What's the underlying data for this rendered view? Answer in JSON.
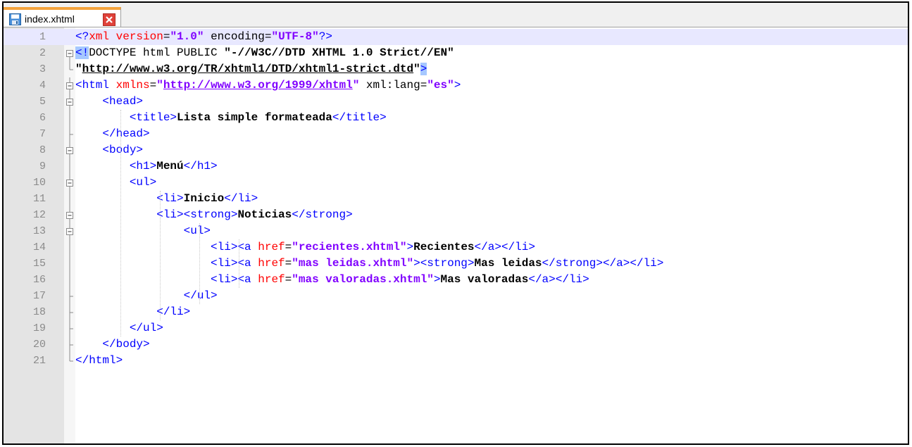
{
  "tab": {
    "label": "index.xhtml"
  },
  "colors": {
    "tag": "#0000ff",
    "attribute": "#ff0000",
    "value": "#8000ff",
    "current_line": "#e8e8ff",
    "tab_accent": "#f3a33c"
  },
  "lines": [
    {
      "n": "1",
      "current": true,
      "fold": "none",
      "parts": [
        {
          "c": "tag",
          "t": "<?"
        },
        {
          "c": "attr",
          "t": "xml"
        },
        {
          "c": "plain",
          "t": " "
        },
        {
          "c": "attr",
          "t": "version"
        },
        {
          "c": "plain",
          "t": "="
        },
        {
          "c": "val",
          "t": "\"1.0\""
        },
        {
          "c": "plain",
          "t": " "
        },
        {
          "c": "plain",
          "t": "encoding"
        },
        {
          "c": "plain",
          "t": "="
        },
        {
          "c": "val",
          "t": "\"UTF-8\""
        },
        {
          "c": "tag",
          "t": "?>"
        }
      ]
    },
    {
      "n": "2",
      "fold": "open",
      "parts": [
        {
          "c": "tag hl",
          "t": "<!"
        },
        {
          "c": "plain",
          "t": "DOCTYPE html PUBLIC "
        },
        {
          "c": "plain txt",
          "t": "\"-//W3C//DTD XHTML 1.0 Strict//EN\""
        }
      ]
    },
    {
      "n": "3",
      "fold": "end",
      "parts": [
        {
          "c": "plain txt",
          "t": "\""
        },
        {
          "c": "plain txt ulink",
          "t": "http://www.w3.org/TR/xhtml1/DTD/xhtml1-strict.dtd"
        },
        {
          "c": "plain txt",
          "t": "\""
        },
        {
          "c": "tag hl",
          "t": ">"
        }
      ]
    },
    {
      "n": "4",
      "fold": "open",
      "parts": [
        {
          "c": "tag",
          "t": "<html"
        },
        {
          "c": "plain",
          "t": " "
        },
        {
          "c": "attr",
          "t": "xmlns"
        },
        {
          "c": "plain",
          "t": "="
        },
        {
          "c": "val",
          "t": "\""
        },
        {
          "c": "val ulink",
          "t": "http://www.w3.org/1999/xhtml"
        },
        {
          "c": "val",
          "t": "\""
        },
        {
          "c": "plain",
          "t": " xml:lang="
        },
        {
          "c": "val",
          "t": "\"es\""
        },
        {
          "c": "tag",
          "t": ">"
        }
      ]
    },
    {
      "n": "5",
      "fold": "open",
      "parts": [
        {
          "c": "plain",
          "t": "    "
        },
        {
          "c": "tag",
          "t": "<head>"
        }
      ]
    },
    {
      "n": "6",
      "fold": "line",
      "parts": [
        {
          "c": "plain",
          "t": "        "
        },
        {
          "c": "tag",
          "t": "<title>"
        },
        {
          "c": "txt",
          "t": "Lista simple formateada"
        },
        {
          "c": "tag",
          "t": "</title>"
        }
      ]
    },
    {
      "n": "7",
      "fold": "branch-end",
      "parts": [
        {
          "c": "plain",
          "t": "    "
        },
        {
          "c": "tag",
          "t": "</head>"
        }
      ]
    },
    {
      "n": "8",
      "fold": "open",
      "parts": [
        {
          "c": "plain",
          "t": "    "
        },
        {
          "c": "tag",
          "t": "<body>"
        }
      ]
    },
    {
      "n": "9",
      "fold": "line",
      "parts": [
        {
          "c": "plain",
          "t": "        "
        },
        {
          "c": "tag",
          "t": "<h1>"
        },
        {
          "c": "txt",
          "t": "Menú"
        },
        {
          "c": "tag",
          "t": "</h1>"
        }
      ]
    },
    {
      "n": "10",
      "fold": "open",
      "parts": [
        {
          "c": "plain",
          "t": "        "
        },
        {
          "c": "tag",
          "t": "<ul>"
        }
      ]
    },
    {
      "n": "11",
      "fold": "line",
      "parts": [
        {
          "c": "plain",
          "t": "            "
        },
        {
          "c": "tag",
          "t": "<li>"
        },
        {
          "c": "txt",
          "t": "Inicio"
        },
        {
          "c": "tag",
          "t": "</li>"
        }
      ]
    },
    {
      "n": "12",
      "fold": "open",
      "parts": [
        {
          "c": "plain",
          "t": "            "
        },
        {
          "c": "tag",
          "t": "<li><strong>"
        },
        {
          "c": "txt",
          "t": "Noticias"
        },
        {
          "c": "tag",
          "t": "</strong>"
        }
      ]
    },
    {
      "n": "13",
      "fold": "open",
      "parts": [
        {
          "c": "plain",
          "t": "                "
        },
        {
          "c": "tag",
          "t": "<ul>"
        }
      ]
    },
    {
      "n": "14",
      "fold": "line",
      "parts": [
        {
          "c": "plain",
          "t": "                    "
        },
        {
          "c": "tag",
          "t": "<li><a"
        },
        {
          "c": "plain",
          "t": " "
        },
        {
          "c": "attr",
          "t": "href"
        },
        {
          "c": "plain",
          "t": "="
        },
        {
          "c": "val",
          "t": "\"recientes.xhtml\""
        },
        {
          "c": "tag",
          "t": ">"
        },
        {
          "c": "txt",
          "t": "Recientes"
        },
        {
          "c": "tag",
          "t": "</a></li>"
        }
      ]
    },
    {
      "n": "15",
      "fold": "line",
      "parts": [
        {
          "c": "plain",
          "t": "                    "
        },
        {
          "c": "tag",
          "t": "<li><a"
        },
        {
          "c": "plain",
          "t": " "
        },
        {
          "c": "attr",
          "t": "href"
        },
        {
          "c": "plain",
          "t": "="
        },
        {
          "c": "val",
          "t": "\"mas leidas.xhtml\""
        },
        {
          "c": "tag",
          "t": "><strong>"
        },
        {
          "c": "txt",
          "t": "Mas leidas"
        },
        {
          "c": "tag",
          "t": "</strong></a></li>"
        }
      ]
    },
    {
      "n": "16",
      "fold": "line",
      "parts": [
        {
          "c": "plain",
          "t": "                    "
        },
        {
          "c": "tag",
          "t": "<li><a"
        },
        {
          "c": "plain",
          "t": " "
        },
        {
          "c": "attr",
          "t": "href"
        },
        {
          "c": "plain",
          "t": "="
        },
        {
          "c": "val",
          "t": "\"mas valoradas.xhtml\""
        },
        {
          "c": "tag",
          "t": ">"
        },
        {
          "c": "txt",
          "t": "Mas valoradas"
        },
        {
          "c": "tag",
          "t": "</a></li>"
        }
      ]
    },
    {
      "n": "17",
      "fold": "branch-end",
      "parts": [
        {
          "c": "plain",
          "t": "                "
        },
        {
          "c": "tag",
          "t": "</ul>"
        }
      ]
    },
    {
      "n": "18",
      "fold": "branch-end",
      "parts": [
        {
          "c": "plain",
          "t": "            "
        },
        {
          "c": "tag",
          "t": "</li>"
        }
      ]
    },
    {
      "n": "19",
      "fold": "branch-end",
      "parts": [
        {
          "c": "plain",
          "t": "        "
        },
        {
          "c": "tag",
          "t": "</ul>"
        }
      ]
    },
    {
      "n": "20",
      "fold": "branch-end",
      "parts": [
        {
          "c": "plain",
          "t": "    "
        },
        {
          "c": "tag",
          "t": "</body>"
        }
      ]
    },
    {
      "n": "21",
      "fold": "end",
      "parts": [
        {
          "c": "tag",
          "t": "</html>"
        }
      ]
    }
  ]
}
